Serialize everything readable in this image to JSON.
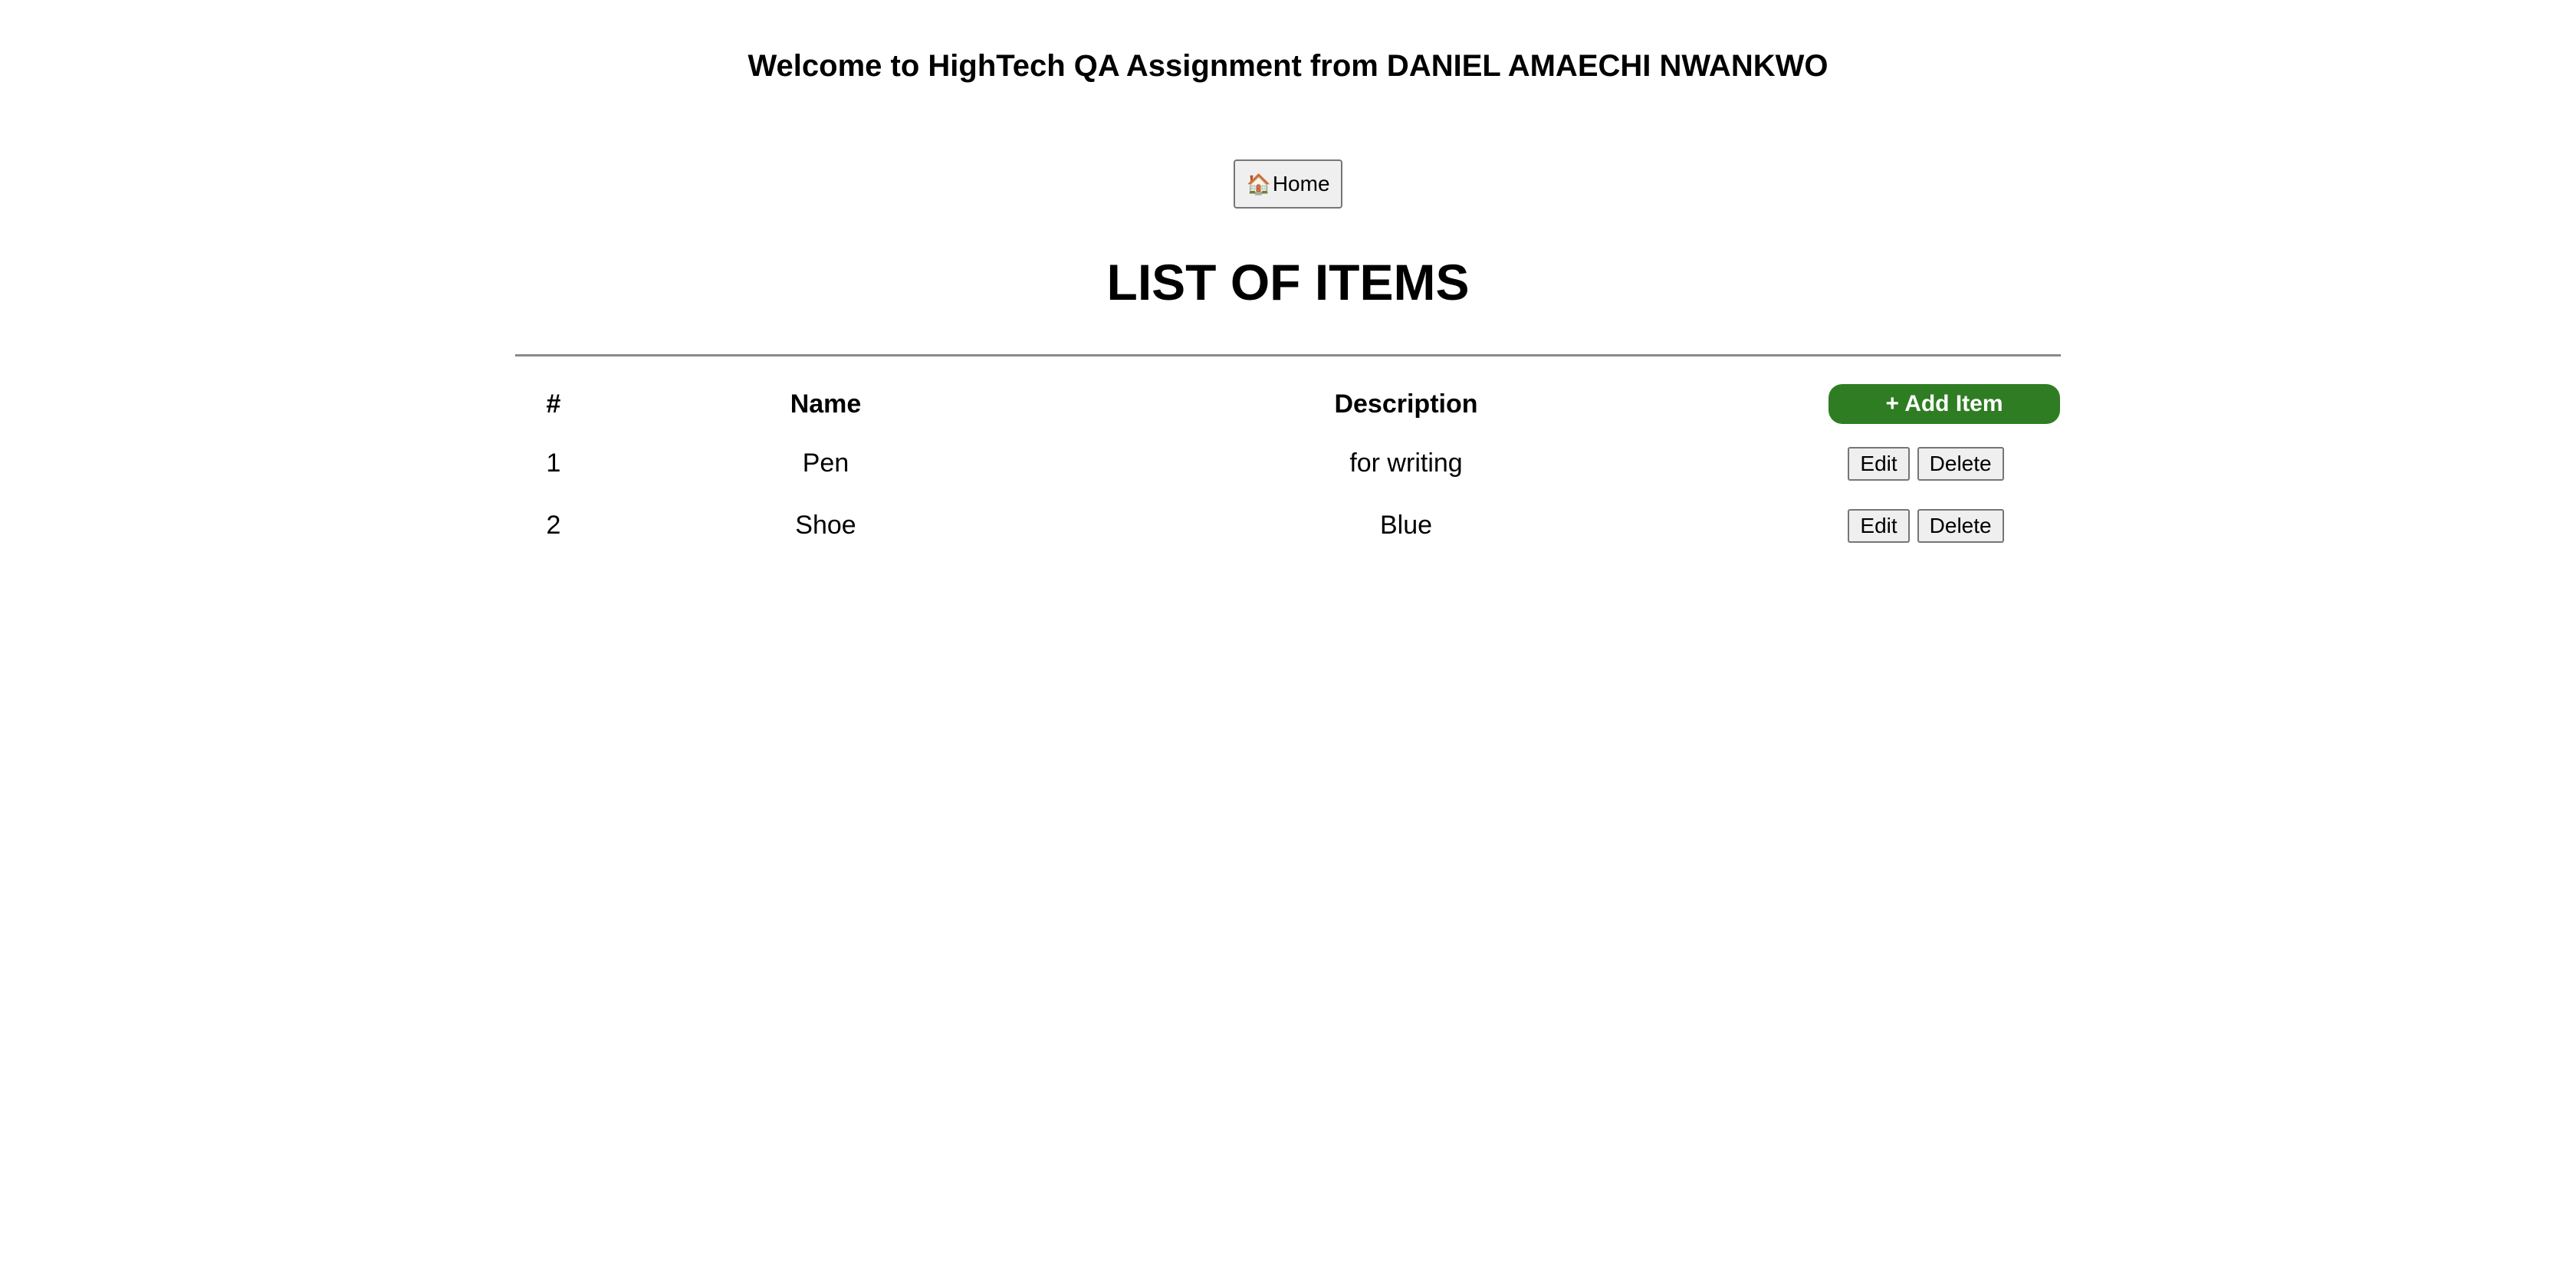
{
  "header": {
    "welcome_text": "Welcome to HighTech QA Assignment from DANIEL AMAECHI NWANKWO"
  },
  "nav": {
    "home_icon": "🏠",
    "home_icon_name": "house-icon",
    "home_label": "Home"
  },
  "main": {
    "title": "LIST OF ITEMS",
    "add_button_label": "+ Add Item",
    "add_button_color": "#2e7d22",
    "columns": [
      "#",
      "Name",
      "Description"
    ],
    "rows": [
      {
        "num": "1",
        "name": "Pen",
        "description": "for writing",
        "edit_label": "Edit",
        "delete_label": "Delete"
      },
      {
        "num": "2",
        "name": "Shoe",
        "description": "Blue",
        "edit_label": "Edit",
        "delete_label": "Delete"
      }
    ]
  }
}
